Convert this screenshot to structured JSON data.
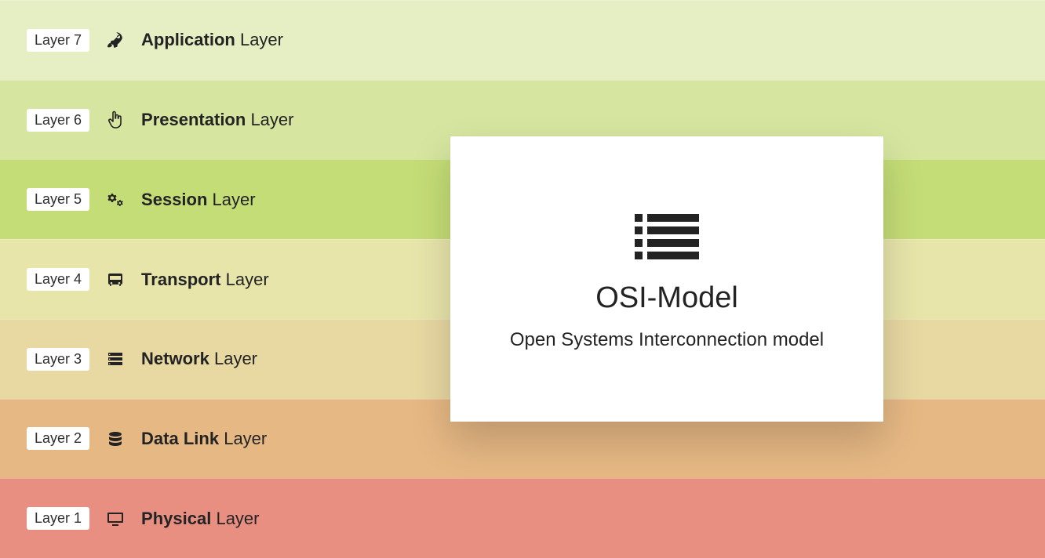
{
  "card": {
    "title": "OSI-Model",
    "subtitle": "Open Systems Interconnection model"
  },
  "suffix": "Layer",
  "layers": [
    {
      "num": "Layer 7",
      "name": "Application",
      "icon": "rocket-icon",
      "color": "c7"
    },
    {
      "num": "Layer 6",
      "name": "Presentation",
      "icon": "pointer-icon",
      "color": "c6"
    },
    {
      "num": "Layer 5",
      "name": "Session",
      "icon": "gears-icon",
      "color": "c5"
    },
    {
      "num": "Layer 4",
      "name": "Transport",
      "icon": "bus-icon",
      "color": "c4"
    },
    {
      "num": "Layer 3",
      "name": "Network",
      "icon": "server-icon",
      "color": "c3"
    },
    {
      "num": "Layer 2",
      "name": "Data Link",
      "icon": "database-icon",
      "color": "c2"
    },
    {
      "num": "Layer 1",
      "name": "Physical",
      "icon": "monitor-icon",
      "color": "c1"
    }
  ]
}
